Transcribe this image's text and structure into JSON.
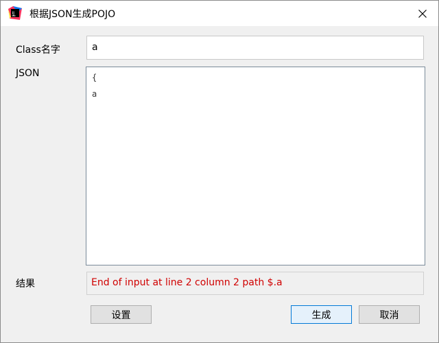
{
  "window": {
    "title": "根据JSON生成POJO",
    "app_icon_text": "IJ"
  },
  "form": {
    "class_label": "Class名字",
    "class_value": "a",
    "json_label": "JSON",
    "json_lines": [
      "{",
      "a"
    ],
    "result_label": "结果",
    "result_text": "End of input at line 2 column 2 path $.a"
  },
  "buttons": {
    "settings": "设置",
    "generate": "生成",
    "cancel": "取消"
  },
  "colors": {
    "error_text": "#d00000",
    "primary_button_border": "#0078d7"
  },
  "icons": {
    "app": "intellij-icon",
    "close": "close-icon"
  }
}
